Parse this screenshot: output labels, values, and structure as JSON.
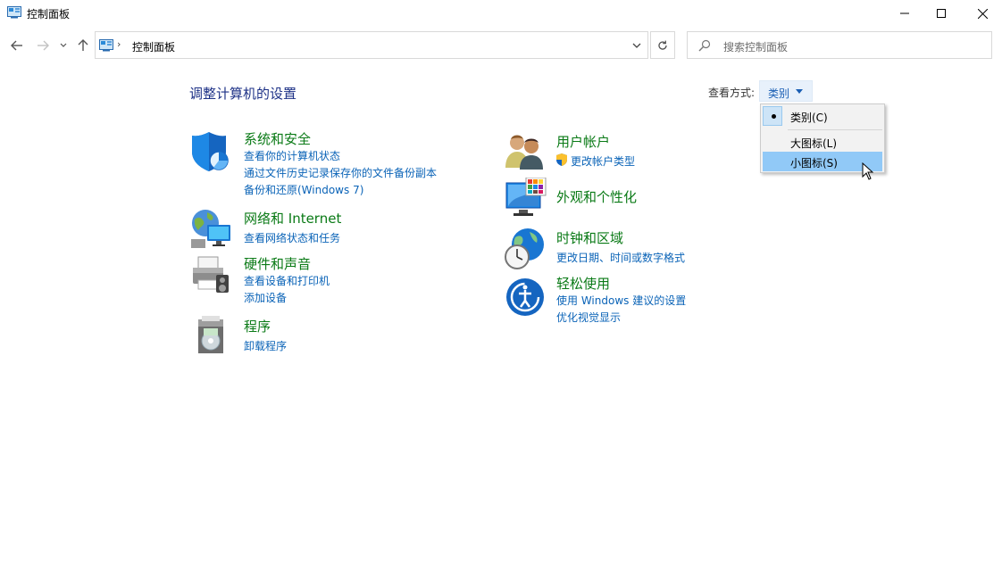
{
  "window": {
    "title": "控制面板"
  },
  "nav": {
    "breadcrumb": "控制面板",
    "search_placeholder": "搜索控制面板"
  },
  "content": {
    "heading": "调整计算机的设置",
    "view_by_label": "查看方式:",
    "view_by_value": "类别"
  },
  "categories": {
    "system_security": {
      "title": "系统和安全",
      "links": [
        "查看你的计算机状态",
        "通过文件历史记录保存你的文件备份副本",
        "备份和还原(Windows 7)"
      ]
    },
    "network": {
      "title": "网络和 Internet",
      "links": [
        "查看网络状态和任务"
      ]
    },
    "hardware": {
      "title": "硬件和声音",
      "links": [
        "查看设备和打印机",
        "添加设备"
      ]
    },
    "programs": {
      "title": "程序",
      "links": [
        "卸载程序"
      ]
    },
    "user_accounts": {
      "title": "用户帐户",
      "links": [
        "更改帐户类型"
      ]
    },
    "appearance": {
      "title": "外观和个性化",
      "links": []
    },
    "clock_region": {
      "title": "时钟和区域",
      "links": [
        "更改日期、时间或数字格式"
      ]
    },
    "ease_of_access": {
      "title": "轻松使用",
      "links": [
        "使用 Windows 建议的设置",
        "优化视觉显示"
      ]
    }
  },
  "view_menu": {
    "items": [
      "类别(C)",
      "大图标(L)",
      "小图标(S)"
    ],
    "checked_index": 0,
    "hovered_index": 2
  },
  "colors": {
    "heading": "#1e3287",
    "category_title": "#0a7a16",
    "link": "#0a63b7",
    "menu_hover": "#91c9f7"
  }
}
